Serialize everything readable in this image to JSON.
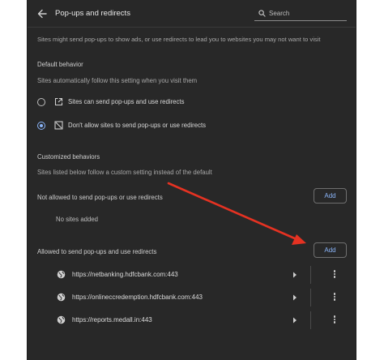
{
  "header": {
    "title": "Pop-ups and redirects",
    "search_placeholder": "Search"
  },
  "intro": "Sites might send pop-ups to show ads, or use redirects to lead you to websites you may not want to visit",
  "default_behavior": {
    "heading": "Default behavior",
    "description": "Sites automatically follow this setting when you visit them",
    "options": [
      {
        "label": "Sites can send pop-ups and use redirects",
        "icon": "external-link-icon",
        "selected": false
      },
      {
        "label": "Don't allow sites to send pop-ups or use redirects",
        "icon": "blocked-window-icon",
        "selected": true
      }
    ]
  },
  "customized": {
    "heading": "Customized behaviors",
    "description": "Sites listed below follow a custom setting instead of the default",
    "not_allowed": {
      "label": "Not allowed to send pop-ups or use redirects",
      "add_label": "Add",
      "empty_text": "No sites added"
    },
    "allowed": {
      "label": "Allowed to send pop-ups and use redirects",
      "add_label": "Add",
      "sites": [
        "https://netbanking.hdfcbank.com:443",
        "https://onlineccredemption.hdfcbank.com:443",
        "https://reports.medall.in:443"
      ]
    }
  },
  "colors": {
    "background": "#282828",
    "accent": "#8ab4f8",
    "annotation_arrow": "#e53222"
  }
}
